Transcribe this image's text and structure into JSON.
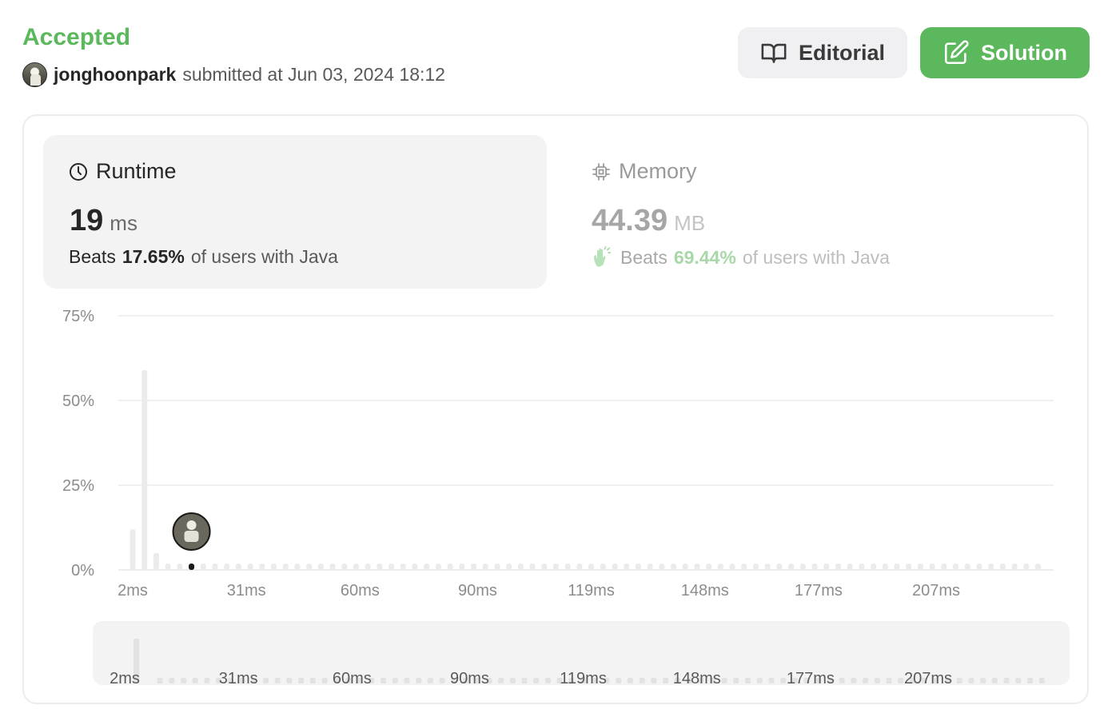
{
  "header": {
    "status": "Accepted",
    "username": "jonghoonpark",
    "submitted_text": "submitted at Jun 03, 2024 18:12",
    "editorial_label": "Editorial",
    "solution_label": "Solution"
  },
  "runtime": {
    "title": "Runtime",
    "value": "19",
    "unit": "ms",
    "beats_label": "Beats",
    "percent": "17.65%",
    "rest": "of users with Java"
  },
  "memory": {
    "title": "Memory",
    "value": "44.39",
    "unit": "MB",
    "beats_label": "Beats",
    "percent": "69.44%",
    "rest": "of users with Java"
  },
  "colors": {
    "accent_green": "#5cb85c",
    "bar_gray": "#ebebeb",
    "highlight_bar": "#1a1a1a"
  },
  "chart_data": {
    "type": "bar",
    "y_ticks": [
      "75%",
      "50%",
      "25%",
      "0%"
    ],
    "ylim": [
      0,
      75
    ],
    "x_tick_labels": [
      "2ms",
      "31ms",
      "60ms",
      "90ms",
      "119ms",
      "148ms",
      "177ms",
      "207ms"
    ],
    "x_tick_positions": [
      2,
      31,
      60,
      90,
      119,
      148,
      177,
      207
    ],
    "bins": [
      {
        "x": 2,
        "y": 12
      },
      {
        "x": 5,
        "y": 59
      },
      {
        "x": 8,
        "y": 5
      }
    ],
    "small_bar_value": 1,
    "bin_count": 80,
    "highlight": {
      "x": 17,
      "label": "19 ms"
    },
    "nav_tick_labels": [
      "2ms",
      "31ms",
      "60ms",
      "90ms",
      "119ms",
      "148ms",
      "177ms",
      "207ms"
    ]
  }
}
